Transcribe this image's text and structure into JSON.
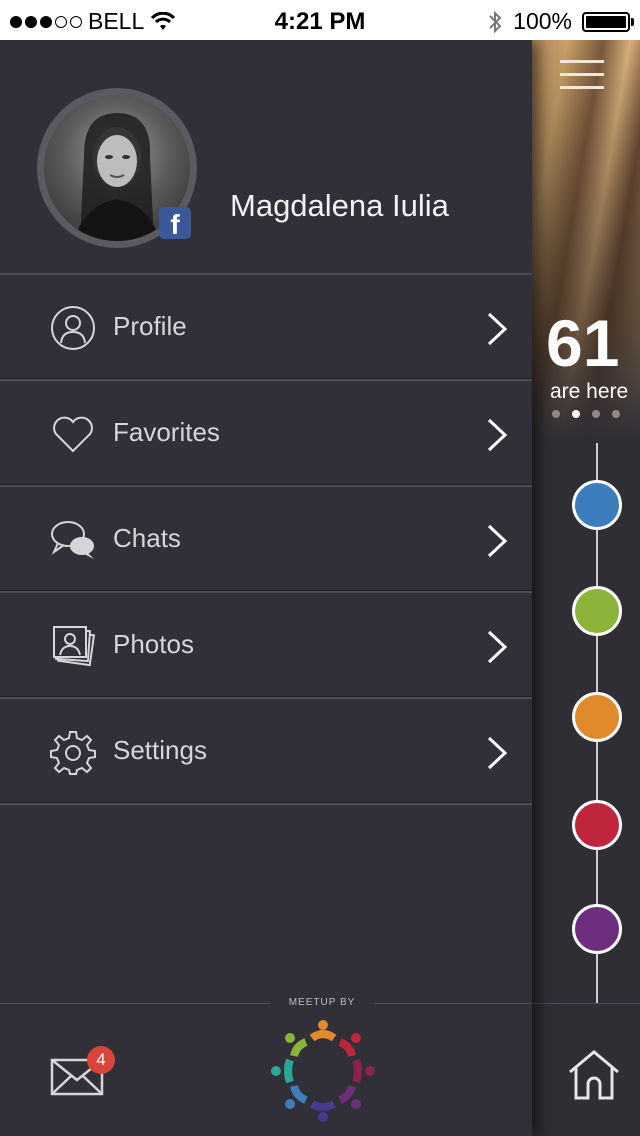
{
  "status_bar": {
    "carrier": "BELL",
    "time": "4:21 PM",
    "battery": "100%"
  },
  "user": {
    "name": "Magdalena Iulia",
    "social_badge": "f"
  },
  "menu": [
    {
      "label": "Profile",
      "icon": "profile-icon"
    },
    {
      "label": "Favorites",
      "icon": "heart-icon"
    },
    {
      "label": "Chats",
      "icon": "chat-bubbles-icon"
    },
    {
      "label": "Photos",
      "icon": "photos-icon"
    },
    {
      "label": "Settings",
      "icon": "gear-icon"
    }
  ],
  "footer": {
    "brand_caption": "MEETUP BY",
    "unread_messages": "4"
  },
  "side_panel": {
    "count": "61",
    "count_label": "are here",
    "active_page": 2,
    "page_count": 4,
    "category_colors": [
      "#3b7dbd",
      "#8cb43b",
      "#e08a2c",
      "#c0253e",
      "#6e2e7e"
    ]
  },
  "colors": {
    "drawer_bg": "#312f38",
    "badge_red": "#d9443b",
    "facebook_blue": "#3b5998"
  }
}
